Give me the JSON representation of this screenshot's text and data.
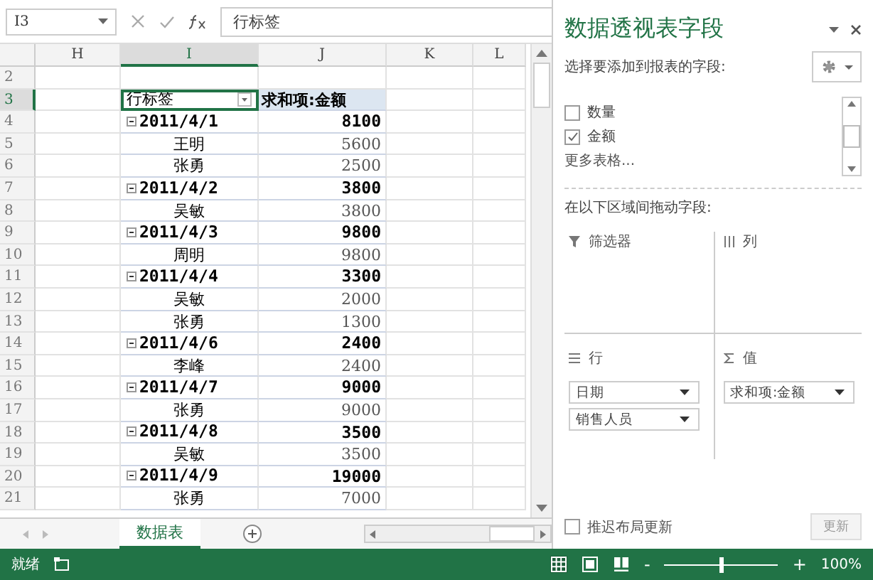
{
  "formula_bar": {
    "name_box": "I3",
    "value": "行标签"
  },
  "columns": [
    {
      "label": "H",
      "selected": false
    },
    {
      "label": "I",
      "selected": true
    },
    {
      "label": "J",
      "selected": false
    },
    {
      "label": "K",
      "selected": false
    },
    {
      "label": "L",
      "selected": false
    }
  ],
  "rows": [
    {
      "number": "2",
      "selected": false
    },
    {
      "number": "3",
      "selected": true,
      "kind": "header",
      "label": "行标签",
      "value": "求和项:金额"
    },
    {
      "number": "4",
      "selected": false,
      "kind": "group",
      "label": "2011/4/1",
      "value": "8100",
      "expanded": true
    },
    {
      "number": "5",
      "selected": false,
      "kind": "item",
      "label": "王明",
      "value": "5600"
    },
    {
      "number": "6",
      "selected": false,
      "kind": "item",
      "label": "张勇",
      "value": "2500"
    },
    {
      "number": "7",
      "selected": false,
      "kind": "group",
      "label": "2011/4/2",
      "value": "3800",
      "expanded": true
    },
    {
      "number": "8",
      "selected": false,
      "kind": "item",
      "label": "吴敏",
      "value": "3800"
    },
    {
      "number": "9",
      "selected": false,
      "kind": "group",
      "label": "2011/4/3",
      "value": "9800",
      "expanded": true
    },
    {
      "number": "10",
      "selected": false,
      "kind": "item",
      "label": "周明",
      "value": "9800"
    },
    {
      "number": "11",
      "selected": false,
      "kind": "group",
      "label": "2011/4/4",
      "value": "3300",
      "expanded": true
    },
    {
      "number": "12",
      "selected": false,
      "kind": "item",
      "label": "吴敏",
      "value": "2000"
    },
    {
      "number": "13",
      "selected": false,
      "kind": "item",
      "label": "张勇",
      "value": "1300"
    },
    {
      "number": "14",
      "selected": false,
      "kind": "group",
      "label": "2011/4/6",
      "value": "2400",
      "expanded": true
    },
    {
      "number": "15",
      "selected": false,
      "kind": "item",
      "label": "李峰",
      "value": "2400"
    },
    {
      "number": "16",
      "selected": false,
      "kind": "group",
      "label": "2011/4/7",
      "value": "9000",
      "expanded": true
    },
    {
      "number": "17",
      "selected": false,
      "kind": "item",
      "label": "张勇",
      "value": "9000"
    },
    {
      "number": "18",
      "selected": false,
      "kind": "group",
      "label": "2011/4/8",
      "value": "3500",
      "expanded": true
    },
    {
      "number": "19",
      "selected": false,
      "kind": "item",
      "label": "吴敏",
      "value": "3500"
    },
    {
      "number": "20",
      "selected": false,
      "kind": "group",
      "label": "2011/4/9",
      "value": "19000",
      "expanded": true
    },
    {
      "number": "21",
      "selected": false,
      "kind": "item",
      "label": "张勇",
      "value": "7000"
    }
  ],
  "sheet_tabs": [
    {
      "label": "数据表",
      "selected": true
    }
  ],
  "status_bar": {
    "text": "就绪",
    "zoom_out": "-",
    "zoom_in": "+",
    "zoom": "100%",
    "level": 0.5
  },
  "panel": {
    "title": "数据透视表字段",
    "subtitle": "选择要添加到报表的字段:",
    "fields": [
      {
        "label": "数量",
        "checked": false
      },
      {
        "label": "金额",
        "checked": true
      }
    ],
    "more": "更多表格...",
    "drag_hint": "在以下区域间拖动字段:",
    "areas": [
      {
        "kind": "filter",
        "label": "筛选器"
      },
      {
        "kind": "columns",
        "label": "列"
      },
      {
        "kind": "rows",
        "label": "行",
        "items": [
          "日期",
          "销售人员"
        ]
      },
      {
        "kind": "values",
        "label": "值",
        "items": [
          "求和项:金额"
        ]
      }
    ],
    "defer": {
      "label": "推迟布局更新",
      "checked": false
    },
    "update_button": "更新"
  }
}
